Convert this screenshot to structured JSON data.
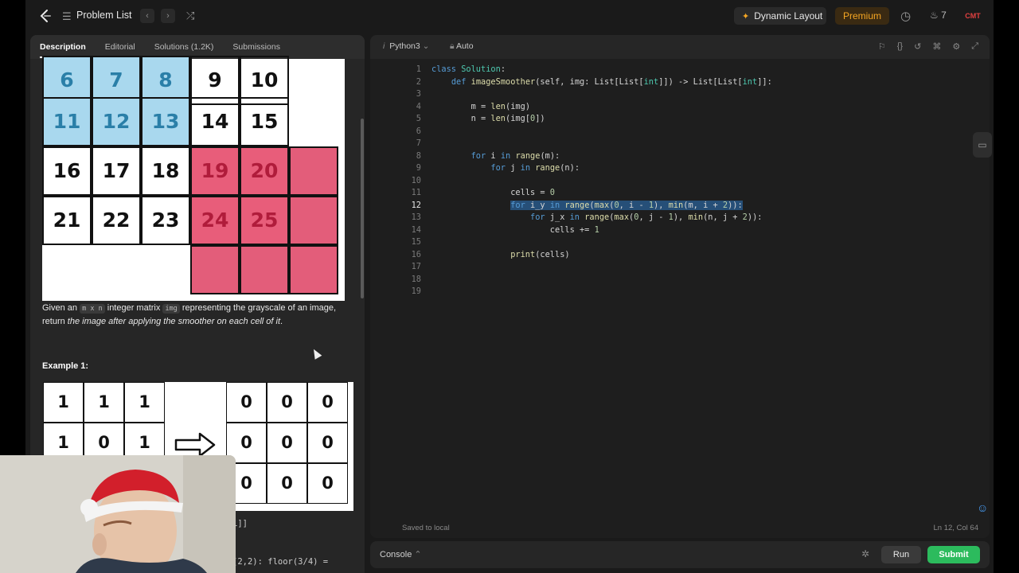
{
  "colors": {
    "accent_orange": "#f5a623",
    "submit_green": "#2cbb5d",
    "blue_cell": "#a9d8ee",
    "red_cell": "#e85d7a"
  },
  "topbar": {
    "problem_list": "Problem List",
    "dynamic_layout": "Dynamic Layout",
    "premium": "Premium",
    "streak": "7",
    "avatar_text": "CMT"
  },
  "left": {
    "tabs": [
      "Description",
      "Editorial",
      "Solutions (1.2K)",
      "Submissions"
    ],
    "grid_rows": [
      [
        "6",
        "7",
        "8",
        "9",
        "10",
        ""
      ],
      [
        "11",
        "12",
        "13",
        "14",
        "15",
        ""
      ],
      [
        "16",
        "17",
        "18",
        "19",
        "20",
        ""
      ],
      [
        "21",
        "22",
        "23",
        "24",
        "25",
        ""
      ]
    ],
    "desc_1": "Given an ",
    "desc_code_m": "m x n",
    "desc_2": " integer matrix ",
    "desc_code_img": "img",
    "desc_3": " representing the grayscale of an image,",
    "desc_4": "return ",
    "desc_italic": "the image after applying the smoother on each cell of it",
    "desc_5": ".",
    "example_title": "Example 1:",
    "ex_input": [
      [
        "1",
        "1",
        "1"
      ],
      [
        "1",
        "0",
        "1"
      ],
      [
        "1",
        "1",
        "1"
      ]
    ],
    "ex_output": [
      [
        "0",
        "0",
        "0"
      ],
      [
        "0",
        "0",
        "0"
      ],
      [
        "0",
        "0",
        "0"
      ]
    ],
    "output_frag_1": "1]]",
    "output_frag_2": "(2,2): floor(3/4) ="
  },
  "editor": {
    "language": "Python3",
    "auto": "Auto",
    "lines": [
      "1",
      "2",
      "3",
      "4",
      "5",
      "6",
      "7",
      "8",
      "9",
      "10",
      "11",
      "12",
      "13",
      "14",
      "15",
      "16",
      "17",
      "18",
      "19"
    ],
    "saved": "Saved to local",
    "position": "Ln 12, Col 64"
  },
  "console": {
    "label": "Console",
    "run": "Run",
    "submit": "Submit"
  }
}
